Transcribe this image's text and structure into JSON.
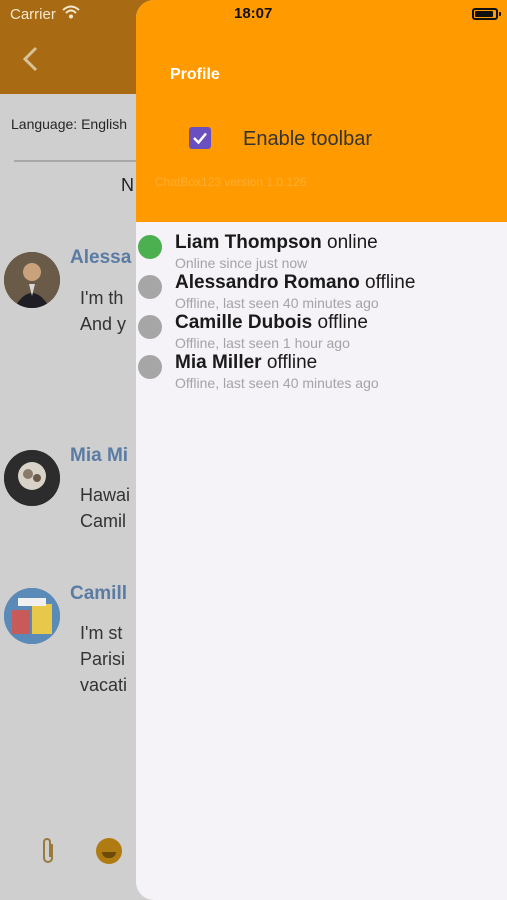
{
  "status_bar": {
    "carrier": "Carrier",
    "time": "18:07"
  },
  "background": {
    "language_label": "Language: English",
    "header_char": "N",
    "messages": [
      {
        "name": "Alessa",
        "lines": [
          "I'm th",
          "And y"
        ]
      },
      {
        "name": "Mia Mi",
        "lines": [
          "Hawai",
          "Camil"
        ]
      },
      {
        "name": "Camill",
        "lines": [
          "I'm st",
          "Parisi",
          "vacati"
        ]
      }
    ]
  },
  "drawer": {
    "profile_label": "Profile",
    "toolbar": {
      "label": "Enable toolbar",
      "checked": true
    },
    "version": "ChatBox123 version 1.0.126",
    "colors": {
      "header": "#ff9a00",
      "online": "#4caf50",
      "offline": "#a6a6a6"
    },
    "users": [
      {
        "name": "Liam Thompson",
        "status": "online",
        "detail": "Online since just now"
      },
      {
        "name": "Alessandro Romano",
        "status": "offline",
        "detail": "Offline, last seen 40 minutes ago"
      },
      {
        "name": "Camille Dubois",
        "status": "offline",
        "detail": "Offline, last seen 1 hour ago"
      },
      {
        "name": "Mia Miller",
        "status": "offline",
        "detail": "Offline, last seen 40 minutes ago"
      }
    ]
  }
}
